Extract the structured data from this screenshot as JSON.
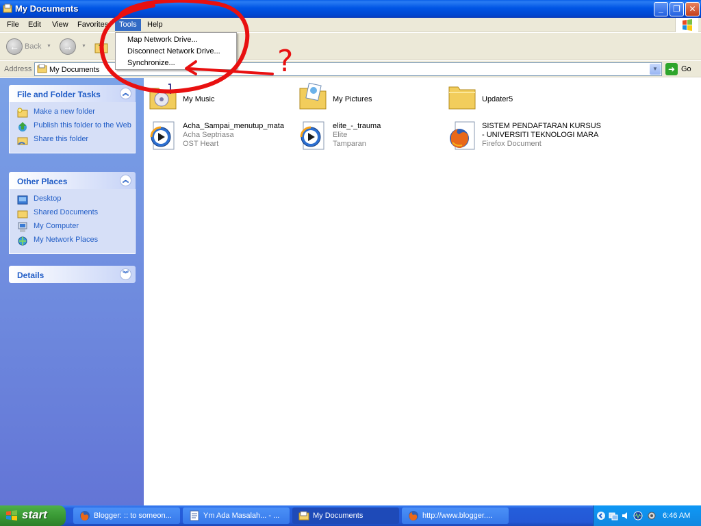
{
  "window": {
    "title": "My Documents"
  },
  "menubar": {
    "items": [
      "File",
      "Edit",
      "View",
      "Favorites",
      "Tools",
      "Help"
    ],
    "active": "Tools"
  },
  "tools_menu": {
    "items": [
      "Map Network Drive...",
      "Disconnect Network Drive...",
      "Synchronize..."
    ]
  },
  "toolbar": {
    "back_label": "Back"
  },
  "address": {
    "label": "Address",
    "value": "My Documents",
    "go_label": "Go"
  },
  "taskpane": {
    "file_tasks": {
      "title": "File and Folder Tasks",
      "links": [
        "Make a new folder",
        "Publish this folder to the Web",
        "Share this folder"
      ]
    },
    "other_places": {
      "title": "Other Places",
      "links": [
        "Desktop",
        "Shared Documents",
        "My Computer",
        "My Network Places"
      ]
    },
    "details": {
      "title": "Details"
    }
  },
  "files": [
    {
      "name": "My Music",
      "type": "music-folder"
    },
    {
      "name": "My Pictures",
      "type": "pictures-folder"
    },
    {
      "name": "Updater5",
      "type": "folder"
    },
    {
      "name": "Acha_Sampai_menutup_mata",
      "line2": "Acha Septriasa",
      "line3": "OST Heart",
      "type": "media"
    },
    {
      "name": "elite_-_trauma",
      "line2": "Elite",
      "line3": "Tamparan",
      "type": "media"
    },
    {
      "name": "SISTEM PENDAFTARAN KURSUS",
      "name2": "- UNIVERSITI TEKNOLOGI MARA",
      "line2": "Firefox Document",
      "type": "firefox"
    }
  ],
  "annotation": {
    "mark": "?"
  },
  "taskbar": {
    "start_label": "start",
    "items": [
      {
        "label": "Blogger: :: to someon...",
        "icon": "firefox-icon"
      },
      {
        "label": "Ym Ada Masalah... - ...",
        "icon": "notepad-icon"
      },
      {
        "label": "My Documents",
        "icon": "folder-icon",
        "active": true
      },
      {
        "label": "http://www.blogger....",
        "icon": "firefox-icon"
      }
    ],
    "clock": "6:46 AM"
  },
  "colors": {
    "title_blue": "#0055e5",
    "task_pane_blue": "#6375d6",
    "link_blue": "#215dc6",
    "annotation_red": "#e81010",
    "start_green": "#3a9a35"
  }
}
